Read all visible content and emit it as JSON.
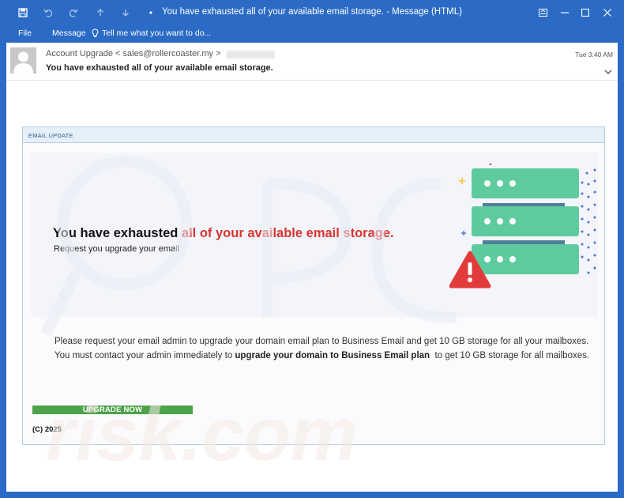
{
  "window": {
    "title": "You have exhausted all of your available email storage. - Message (HTML)",
    "icons": [
      "save-icon",
      "undo-icon",
      "redo-icon",
      "up-arrow-icon",
      "down-arrow-icon",
      "quick-access-customize-icon"
    ],
    "controls": [
      "ribbon-display-icon",
      "minimize-icon",
      "maximize-icon",
      "close-icon"
    ]
  },
  "ribbon": {
    "file": "File",
    "message": "Message",
    "tell_me": "Tell me what you want to do..."
  },
  "message": {
    "sender": "Account Upgrade < sales@rollercoaster.my >",
    "subject": "You have exhausted all of your available email storage.",
    "time": "Tue 3:40 AM"
  },
  "email": {
    "header_label": "EMAIL UPDATE",
    "headline_plain": "You have exhausted ",
    "headline_red": "all of your available email storage.",
    "subline": "Request you upgrade your email",
    "para_1": "Please request your email admin to upgrade your domain email plan to Business Email and get 10 GB storage for all your mailboxes.",
    "para_2a": "You must contact your admin immediately to ",
    "para_2b": "upgrade your domain to Business Email plan",
    "para_2c": "  to get 10 GB storage for all mailboxes.",
    "button": "UPGRADE NOW",
    "copyright": "(C) 2025"
  },
  "colors": {
    "frame_blue": "#2b6bc5",
    "headline_red": "#d8342f",
    "button_green": "#4ea24a",
    "server_green": "#5ecb9e",
    "warning_red": "#e23b3b"
  },
  "watermark_icon": "pcrisk-watermark"
}
